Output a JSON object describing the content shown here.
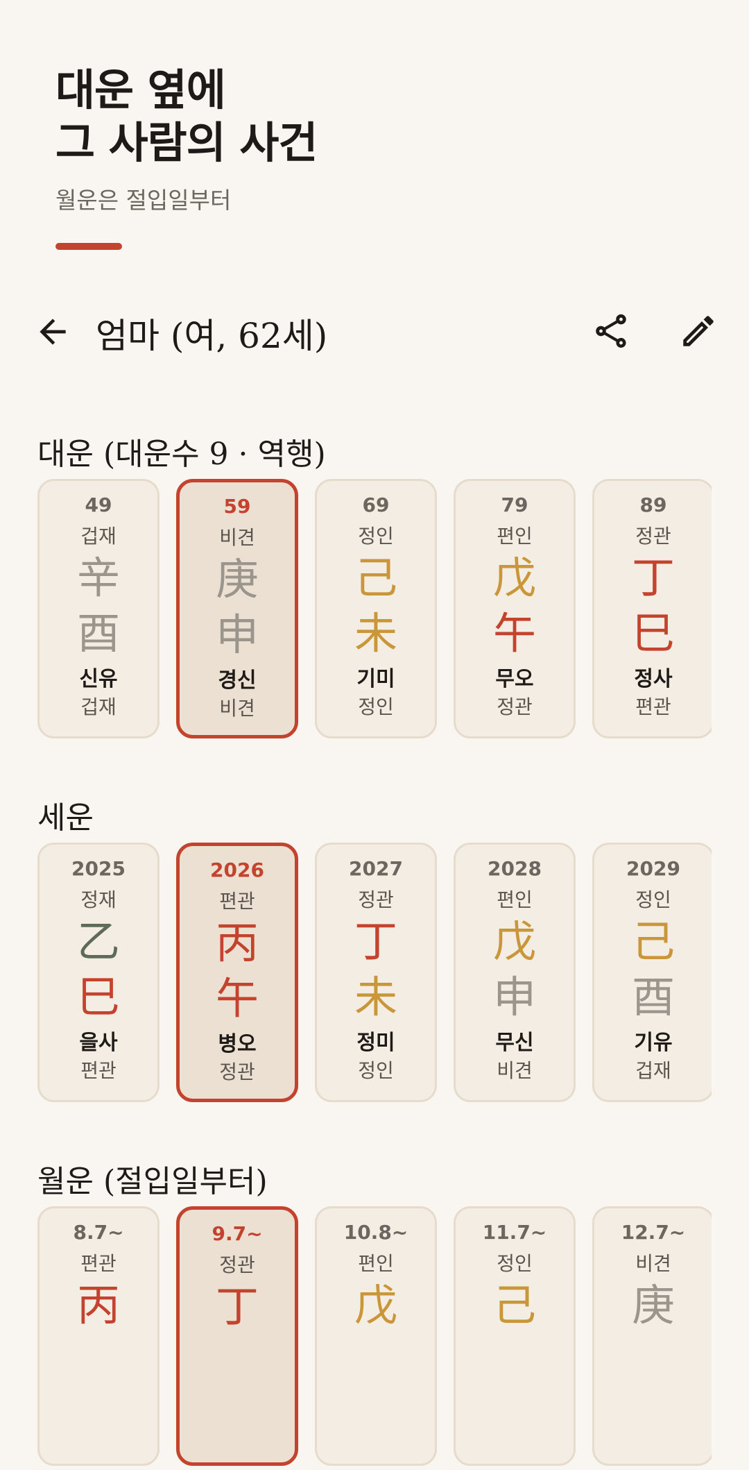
{
  "hero": {
    "title_line1": "대운 옆에",
    "title_line2": "그 사람의 사건",
    "subtitle": "월운은 절입일부터"
  },
  "appbar": {
    "title": "엄마 (여, 62세)",
    "back_icon": "arrow-back-icon",
    "share_icon": "share-icon",
    "edit_icon": "edit-pencil-icon"
  },
  "colors": {
    "accent": "#c4432e",
    "metal": "#9a958d",
    "earth": "#c9963a",
    "fire": "#c4432e",
    "wood": "#5d6b58"
  },
  "daeun": {
    "title": "대운 (대운수 9 · 역행)",
    "cards": [
      {
        "top": "49",
        "ten_god_top": "겁재",
        "stem": "辛",
        "stem_color": "#9a958d",
        "branch": "酉",
        "branch_color": "#9a958d",
        "korean": "신유",
        "ten_god_bottom": "겁재",
        "selected": false
      },
      {
        "top": "59",
        "ten_god_top": "비견",
        "stem": "庚",
        "stem_color": "#9a958d",
        "branch": "申",
        "branch_color": "#9a958d",
        "korean": "경신",
        "ten_god_bottom": "비견",
        "selected": true
      },
      {
        "top": "69",
        "ten_god_top": "정인",
        "stem": "己",
        "stem_color": "#c9963a",
        "branch": "未",
        "branch_color": "#c9963a",
        "korean": "기미",
        "ten_god_bottom": "정인",
        "selected": false
      },
      {
        "top": "79",
        "ten_god_top": "편인",
        "stem": "戊",
        "stem_color": "#c9963a",
        "branch": "午",
        "branch_color": "#c4432e",
        "korean": "무오",
        "ten_god_bottom": "정관",
        "selected": false
      },
      {
        "top": "89",
        "ten_god_top": "정관",
        "stem": "丁",
        "stem_color": "#c4432e",
        "branch": "巳",
        "branch_color": "#c4432e",
        "korean": "정사",
        "ten_god_bottom": "편관",
        "selected": false
      }
    ]
  },
  "seun": {
    "title": "세운",
    "cards": [
      {
        "top": "2025",
        "ten_god_top": "정재",
        "stem": "乙",
        "stem_color": "#5d6b58",
        "branch": "巳",
        "branch_color": "#c4432e",
        "korean": "을사",
        "ten_god_bottom": "편관",
        "selected": false
      },
      {
        "top": "2026",
        "ten_god_top": "편관",
        "stem": "丙",
        "stem_color": "#c4432e",
        "branch": "午",
        "branch_color": "#c4432e",
        "korean": "병오",
        "ten_god_bottom": "정관",
        "selected": true
      },
      {
        "top": "2027",
        "ten_god_top": "정관",
        "stem": "丁",
        "stem_color": "#c4432e",
        "branch": "未",
        "branch_color": "#c9963a",
        "korean": "정미",
        "ten_god_bottom": "정인",
        "selected": false
      },
      {
        "top": "2028",
        "ten_god_top": "편인",
        "stem": "戊",
        "stem_color": "#c9963a",
        "branch": "申",
        "branch_color": "#9a958d",
        "korean": "무신",
        "ten_god_bottom": "비견",
        "selected": false
      },
      {
        "top": "2029",
        "ten_god_top": "정인",
        "stem": "己",
        "stem_color": "#c9963a",
        "branch": "酉",
        "branch_color": "#9a958d",
        "korean": "기유",
        "ten_god_bottom": "겁재",
        "selected": false
      }
    ]
  },
  "wolun": {
    "title": "월운 (절입일부터)",
    "cards": [
      {
        "top": "8.7~",
        "ten_god_top": "편관",
        "stem": "丙",
        "stem_color": "#c4432e",
        "branch": "",
        "branch_color": "#c4432e",
        "korean": "",
        "ten_god_bottom": "",
        "selected": false
      },
      {
        "top": "9.7~",
        "ten_god_top": "정관",
        "stem": "丁",
        "stem_color": "#c4432e",
        "branch": "",
        "branch_color": "#c4432e",
        "korean": "",
        "ten_god_bottom": "",
        "selected": true
      },
      {
        "top": "10.8~",
        "ten_god_top": "편인",
        "stem": "戊",
        "stem_color": "#c9963a",
        "branch": "",
        "branch_color": "#c9963a",
        "korean": "",
        "ten_god_bottom": "",
        "selected": false
      },
      {
        "top": "11.7~",
        "ten_god_top": "정인",
        "stem": "己",
        "stem_color": "#c9963a",
        "branch": "",
        "branch_color": "#c9963a",
        "korean": "",
        "ten_god_bottom": "",
        "selected": false
      },
      {
        "top": "12.7~",
        "ten_god_top": "비견",
        "stem": "庚",
        "stem_color": "#9a958d",
        "branch": "",
        "branch_color": "#9a958d",
        "korean": "",
        "ten_god_bottom": "",
        "selected": false
      }
    ]
  }
}
